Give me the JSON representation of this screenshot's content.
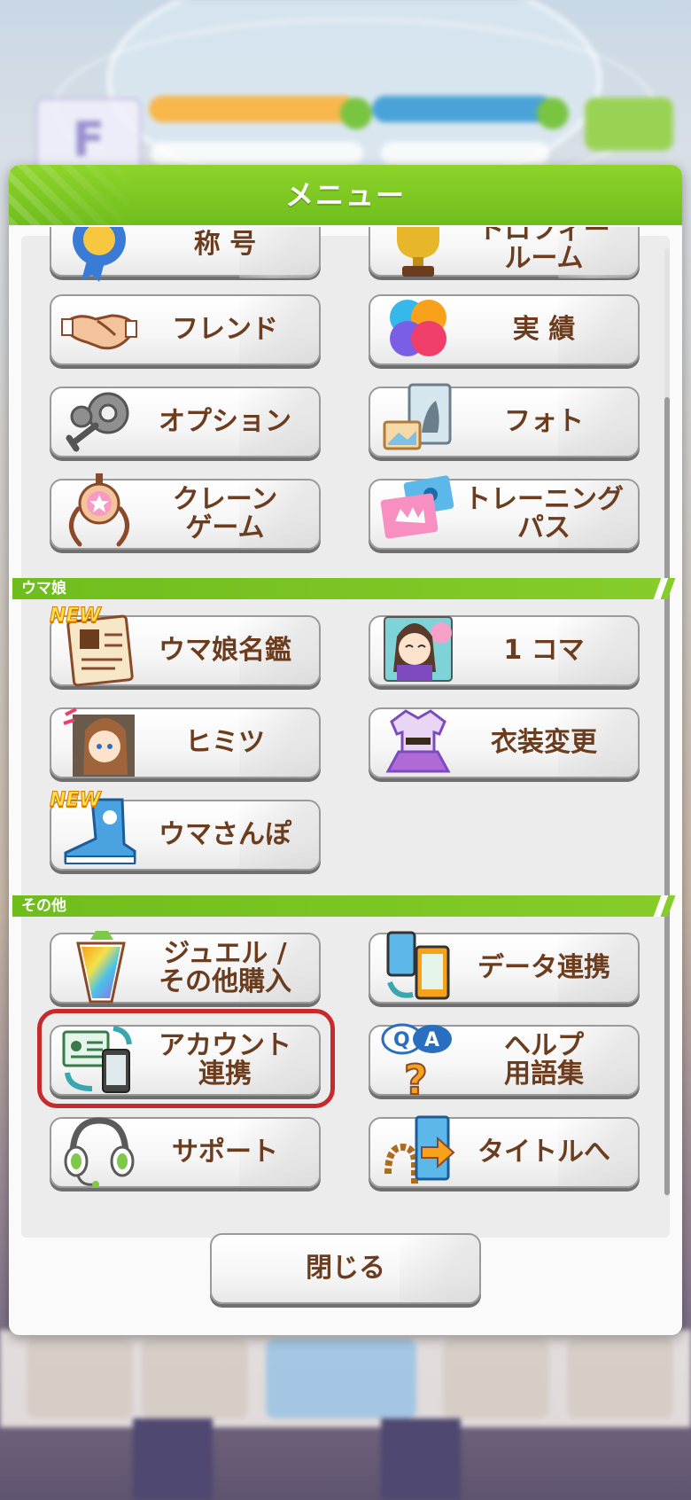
{
  "dialog": {
    "title": "メニュー",
    "close_label": "閉じる"
  },
  "sections": {
    "uma": "ウマ娘",
    "other": "その他"
  },
  "new_badge": "NEW",
  "top_items": [
    {
      "id": "title",
      "label": "称 号",
      "icon": "medal-icon"
    },
    {
      "id": "trophy",
      "label": "トロフィー\nルーム",
      "icon": "trophy-icon"
    },
    {
      "id": "friend",
      "label": "フレンド",
      "icon": "handshake-icon"
    },
    {
      "id": "achievement",
      "label": "実 績",
      "icon": "bubbles-icon"
    },
    {
      "id": "option",
      "label": "オプション",
      "icon": "gear-icon"
    },
    {
      "id": "photo",
      "label": "フォト",
      "icon": "photo-frame-icon"
    },
    {
      "id": "crane",
      "label": "クレーン\nゲーム",
      "icon": "crane-claw-icon"
    },
    {
      "id": "training-pass",
      "label": "トレーニング\nパス",
      "icon": "ticket-icon"
    }
  ],
  "uma_items": [
    {
      "id": "uma-dex",
      "label": "ウマ娘名鑑",
      "icon": "book-icon",
      "new": true
    },
    {
      "id": "one-koma",
      "label": "1 コマ",
      "icon": "character-portrait-icon"
    },
    {
      "id": "secret",
      "label": "ヒミツ",
      "icon": "character-secret-icon"
    },
    {
      "id": "costume",
      "label": "衣装変更",
      "icon": "costume-icon"
    },
    {
      "id": "walk",
      "label": "ウマさんぽ",
      "icon": "sneaker-icon",
      "new": true
    }
  ],
  "other_items": [
    {
      "id": "jewel",
      "label": "ジュエル /\nその他購入",
      "icon": "jewel-icon"
    },
    {
      "id": "data-link",
      "label": "データ連携",
      "icon": "phones-sync-icon"
    },
    {
      "id": "account-link",
      "label": "アカウント\n連携",
      "icon": "id-card-sync-icon"
    },
    {
      "id": "help",
      "label": "ヘルプ\n用語集",
      "icon": "help-bubble-icon"
    },
    {
      "id": "support",
      "label": "サポート",
      "icon": "headset-icon"
    },
    {
      "id": "to-title",
      "label": "タイトルへ",
      "icon": "exit-door-icon"
    }
  ],
  "colors": {
    "header_green": "#7cc51f",
    "label_brown": "#6b3d1e",
    "highlight_red": "#c62b2b"
  }
}
